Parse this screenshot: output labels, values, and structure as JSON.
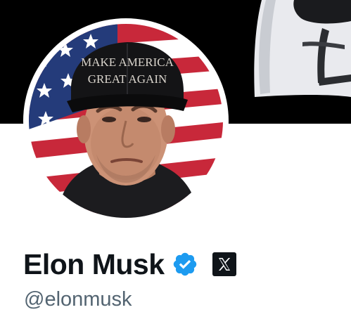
{
  "profile": {
    "display_name": "Elon Musk",
    "handle": "@elonmusk",
    "avatar_cap_text_line1": "MAKE AMERICA",
    "avatar_cap_text_line2": "GREAT AGAIN"
  },
  "icons": {
    "verified": "verified-badge-icon",
    "affiliation": "x-logo-icon"
  },
  "colors": {
    "verified_blue": "#1d9bf0",
    "name_text": "#0f1419",
    "handle_text": "#536471",
    "banner_bg": "#000000"
  }
}
